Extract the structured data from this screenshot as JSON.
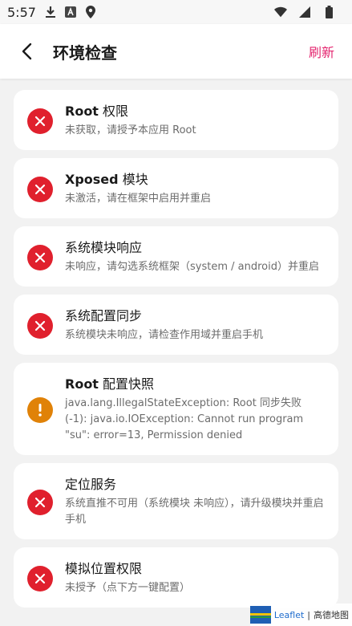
{
  "status_bar": {
    "time": "5:57"
  },
  "app_bar": {
    "title": "环境检查",
    "refresh_label": "刷新"
  },
  "cards": [
    {
      "status": "error",
      "title_bold": "Root",
      "title_rest": " 权限",
      "desc": "未获取，请授予本应用 Root"
    },
    {
      "status": "error",
      "title_bold": "Xposed",
      "title_rest": " 模块",
      "desc": "未激活，请在框架中启用并重启"
    },
    {
      "status": "error",
      "title_bold": "",
      "title_rest": "系统模块响应",
      "desc": "未响应，请勾选系统框架（system / android）并重启"
    },
    {
      "status": "error",
      "title_bold": "",
      "title_rest": "系统配置同步",
      "desc": "系统模块未响应，请检查作用域并重启手机"
    },
    {
      "status": "warning",
      "title_bold": "Root",
      "title_rest": " 配置快照",
      "desc": "java.lang.IllegalStateException: Root 同步失败 (-1): java.io.IOException: Cannot run program \"su\": error=13, Permission denied"
    },
    {
      "status": "error",
      "title_bold": "",
      "title_rest": "定位服务",
      "desc": "系统直推不可用（系统模块 未响应），请升级模块并重启手机"
    },
    {
      "status": "error",
      "title_bold": "",
      "title_rest": "模拟位置权限",
      "desc": "未授予（点下方一键配置）"
    }
  ],
  "map_attribution": {
    "link": "Leaflet",
    "separator": " | ",
    "provider": "高德地图"
  },
  "colors": {
    "error": "#e0202d",
    "warning": "#e08208",
    "accent": "#e4266f"
  }
}
